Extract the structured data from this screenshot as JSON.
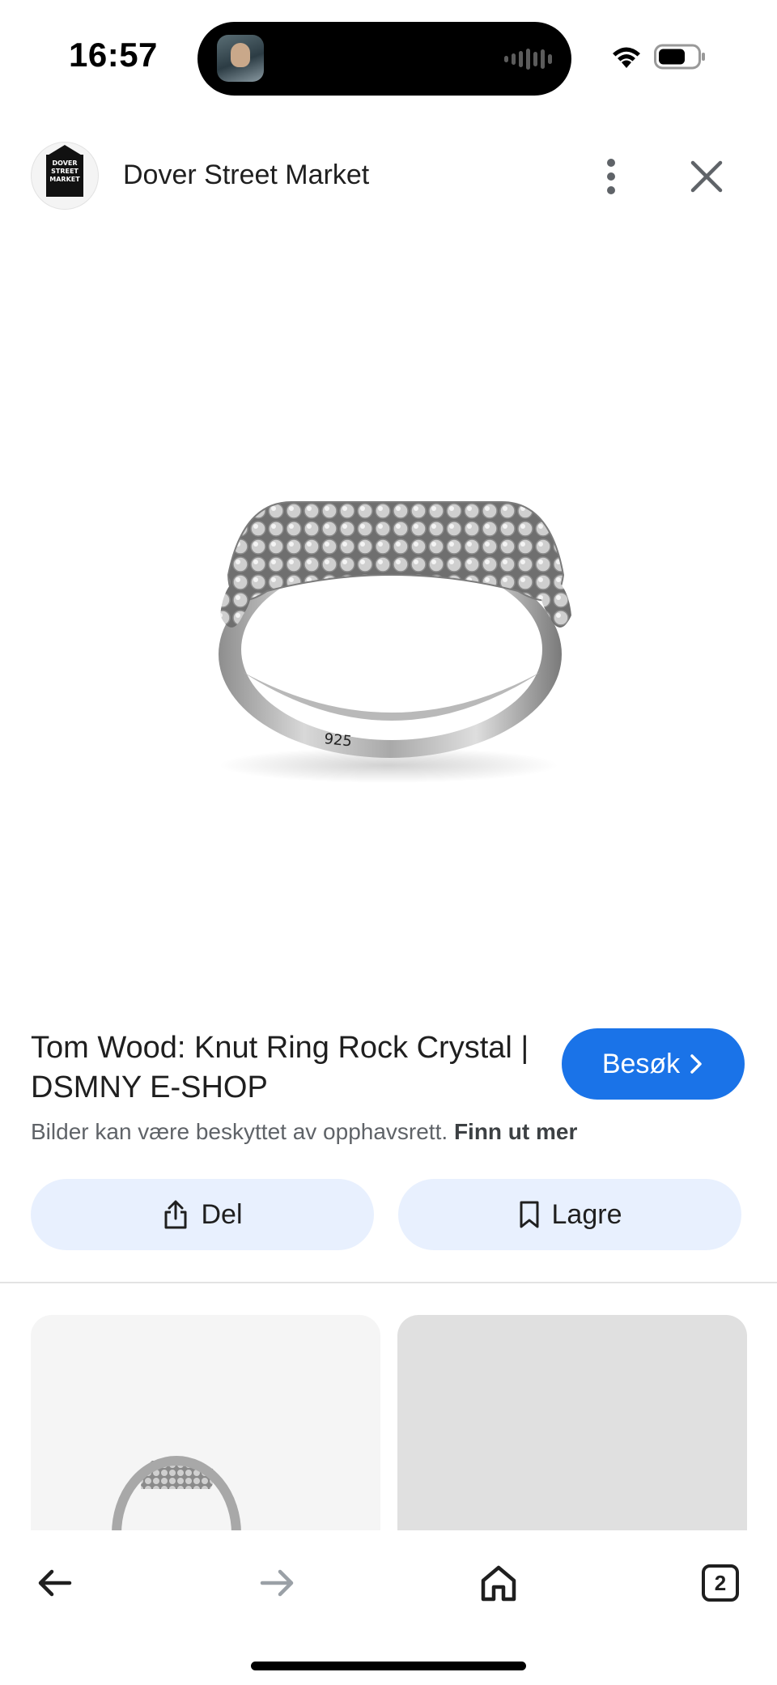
{
  "status_bar": {
    "time": "16:57"
  },
  "header": {
    "site_name": "Dover Street Market",
    "logo_text": "DOVER STREET MARKET",
    "menu_icon": "more-vert-icon",
    "close_icon": "close-icon"
  },
  "main_image": {
    "engraving": "925"
  },
  "result": {
    "title": "Tom Wood: Knut Ring Rock Crystal | DSMNY E-SHOP",
    "visit_label": "Besøk",
    "copyright_text": "Bilder kan være beskyttet av opphavsrett.",
    "copyright_link": "Finn ut mer"
  },
  "actions": {
    "share_label": "Del",
    "save_label": "Lagre"
  },
  "bottom_nav": {
    "tabs_count": "2"
  },
  "colors": {
    "accent": "#1a73e8",
    "action_bg": "#e8f0fe",
    "text_primary": "#1f1f1f",
    "text_secondary": "#5f6368"
  }
}
